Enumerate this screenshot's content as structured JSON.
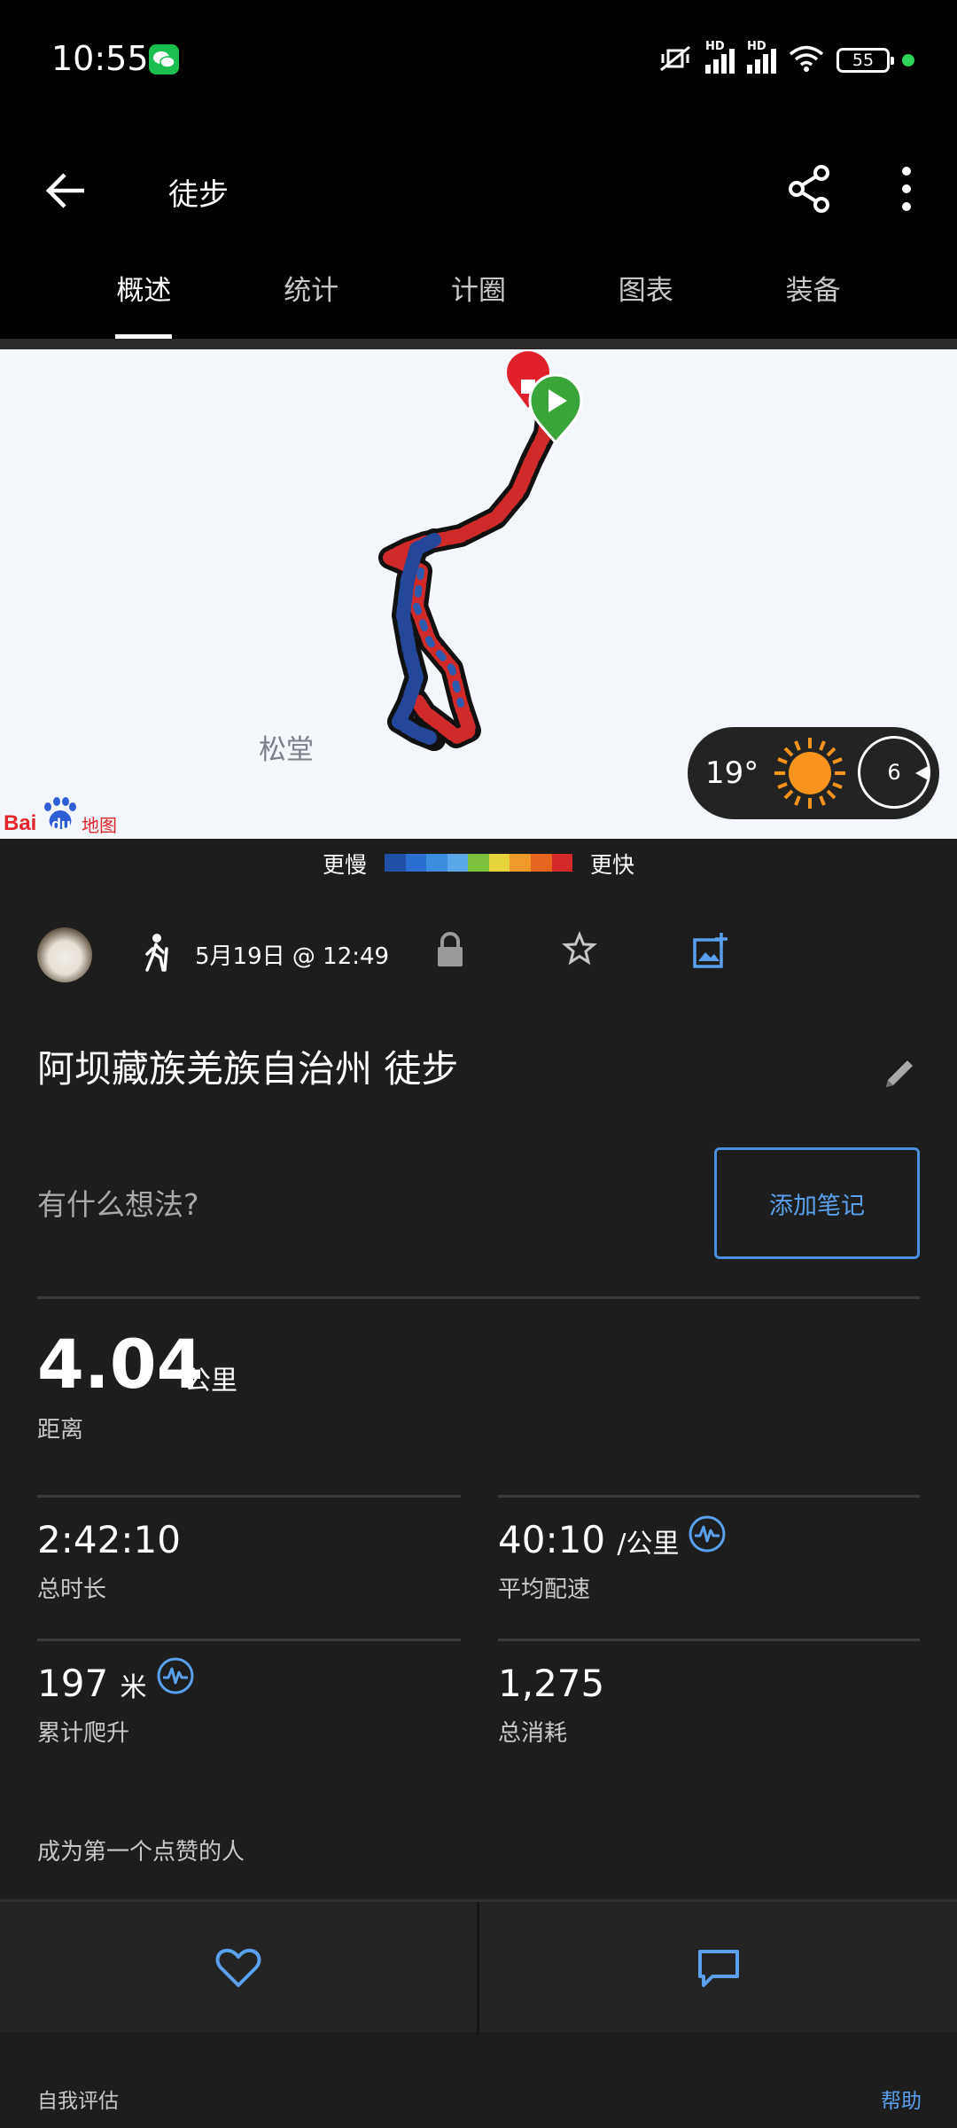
{
  "status_bar": {
    "time": "10:55",
    "signal_label_1": "HD",
    "signal_label_2": "HD",
    "battery": "55",
    "icons": [
      "wechat-icon",
      "mute-vibrate-icon",
      "signal-icon",
      "signal-icon",
      "wifi-icon",
      "battery-icon"
    ]
  },
  "app_bar": {
    "title": "徒步",
    "icons": [
      "back-arrow-icon",
      "share-icon",
      "more-vert-icon"
    ]
  },
  "tabs": [
    {
      "label": "概述",
      "active": true
    },
    {
      "label": "统计",
      "active": false
    },
    {
      "label": "计圈",
      "active": false
    },
    {
      "label": "图表",
      "active": false
    },
    {
      "label": "装备",
      "active": false
    }
  ],
  "map": {
    "place_label": "松堂",
    "provider": "Baidu地图",
    "weather": {
      "temperature": "19°",
      "wind": "6",
      "icon": "sun-icon"
    }
  },
  "pace_legend": {
    "slower": "更慢",
    "faster": "更快",
    "colors": [
      "#1f4fa6",
      "#2a6fd0",
      "#3e8ee0",
      "#5aa8e8",
      "#7cc23a",
      "#e6d23a",
      "#f09a2a",
      "#e8651f",
      "#d42a2a"
    ]
  },
  "activity": {
    "date": "5月19日 @ 12:49",
    "title": "阿坝藏族羌族自治州 徒步",
    "thoughts_placeholder": "有什么想法?",
    "add_note": "添加笔记"
  },
  "stats": {
    "distance": {
      "value": "4.04",
      "unit": "公里",
      "label": "距离"
    },
    "duration": {
      "value": "2:42:10",
      "label": "总时长"
    },
    "pace": {
      "value": "40:10",
      "unit": "/公里",
      "label": "平均配速"
    },
    "ascent": {
      "value": "197",
      "unit": "米",
      "label": "累计爬升"
    },
    "calories": {
      "value": "1,275",
      "label": "总消耗"
    }
  },
  "social": {
    "likes_text": "成为第一个点赞的人"
  },
  "footer": {
    "self_eval": "自我评估",
    "help": "帮助"
  },
  "colors": {
    "accent": "#5aa0ec",
    "start_marker": "#3aa63a",
    "end_marker": "#e0202a"
  }
}
